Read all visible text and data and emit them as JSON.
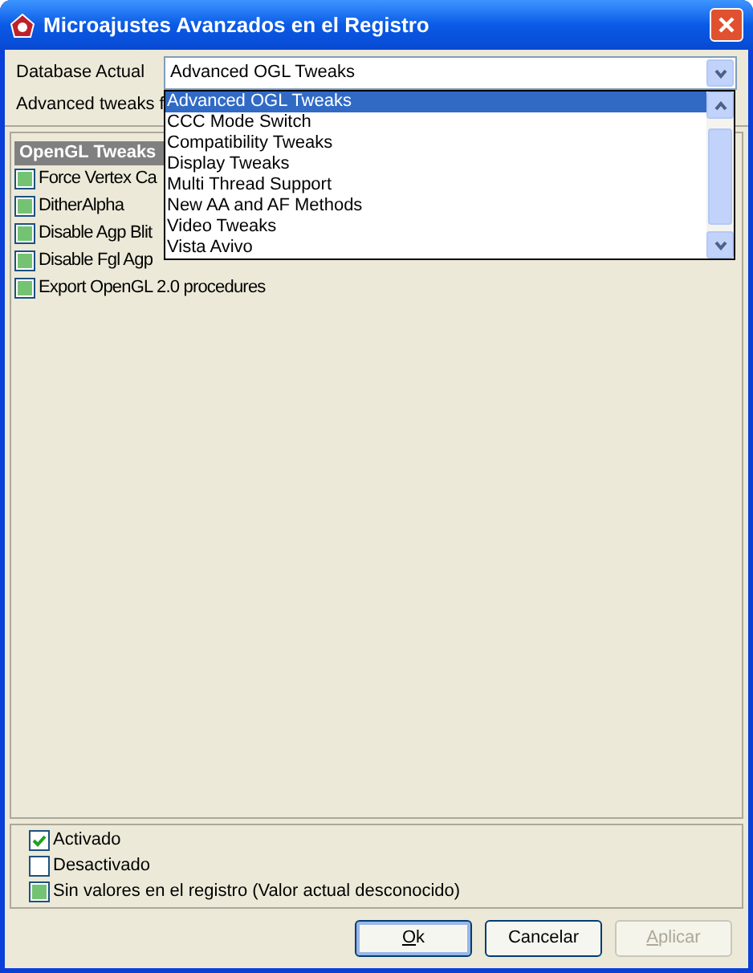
{
  "window": {
    "title": "Microajustes Avanzados en el Registro"
  },
  "database": {
    "label": "Database Actual",
    "value": "Advanced OGL Tweaks",
    "expanded": true,
    "options": [
      {
        "label": "Advanced OGL Tweaks",
        "selected": true
      },
      {
        "label": "CCC Mode Switch",
        "selected": false
      },
      {
        "label": "Compatibility Tweaks",
        "selected": false
      },
      {
        "label": "Display Tweaks",
        "selected": false
      },
      {
        "label": "Multi Thread Support",
        "selected": false
      },
      {
        "label": "New AA and AF Methods",
        "selected": false
      },
      {
        "label": "Video Tweaks",
        "selected": false
      },
      {
        "label": "Vista Avivo",
        "selected": false
      }
    ]
  },
  "description": "Advanced tweaks f",
  "groups": [
    {
      "title": "OpenGL Tweaks",
      "items": [
        {
          "label": "Force Vertex Ca",
          "checked": false,
          "indeterminate": true
        },
        {
          "label": "DitherAlpha",
          "checked": false,
          "indeterminate": true
        },
        {
          "label": "Disable Agp Blit",
          "checked": false,
          "indeterminate": true
        },
        {
          "label": "Disable Fgl Agp",
          "checked": false,
          "indeterminate": true
        },
        {
          "label": "Export OpenGL 2.0 procedures",
          "checked": false,
          "indeterminate": true
        }
      ]
    }
  ],
  "legend": [
    {
      "label": "Activado",
      "checked": true,
      "indeterminate": false
    },
    {
      "label": "Desactivado",
      "checked": false,
      "indeterminate": false
    },
    {
      "label": "Sin valores en el registro (Valor actual desconocido)",
      "checked": false,
      "indeterminate": true
    }
  ],
  "buttons": [
    {
      "label": "Ok",
      "underline_first": true,
      "default": true,
      "disabled": false
    },
    {
      "label": "Cancelar",
      "underline_first": false,
      "default": false,
      "disabled": false
    },
    {
      "label": "Aplicar",
      "underline_first": true,
      "default": false,
      "disabled": true
    }
  ]
}
